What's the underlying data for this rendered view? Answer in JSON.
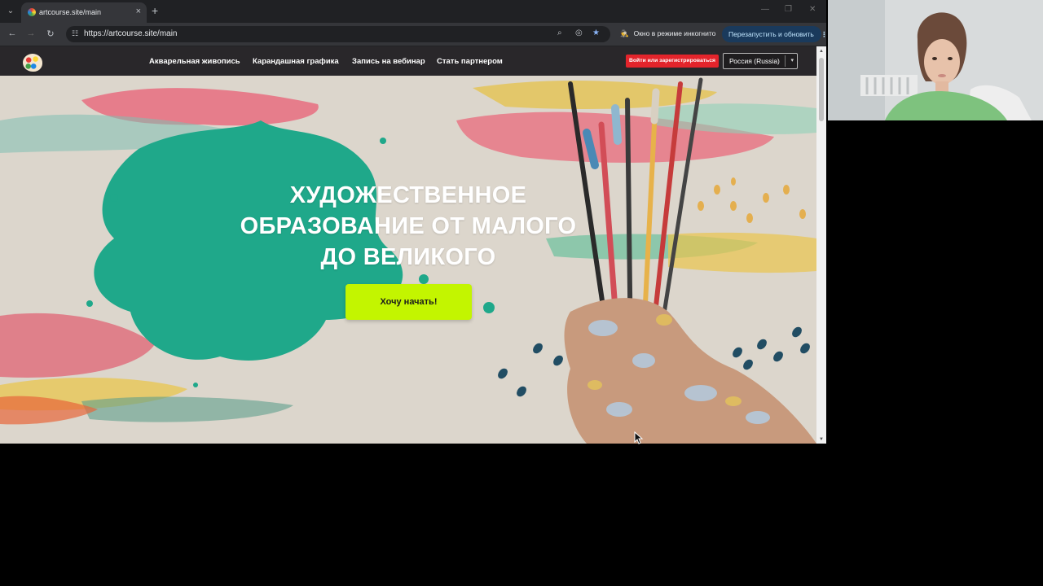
{
  "browser": {
    "tab_title": "artcourse.site/main",
    "tab_close": "×",
    "new_tab": "+",
    "url": "https://artcourse.site/main",
    "incognito_label": "Окно в режиме инкогнито",
    "relaunch_label": "Перезапустить и обновить",
    "relaunch_menu": "⋮",
    "icons": {
      "back": "←",
      "forward": "→",
      "reload": "↻",
      "tab_search": "⌄",
      "minimize": "—",
      "restore": "❐",
      "close": "✕",
      "zoom": "⌕",
      "eye_off": "◎",
      "star": "★",
      "site_info": "☷",
      "incognito": "🕵"
    }
  },
  "site": {
    "nav": {
      "links": [
        "Акварельная живопись",
        "Карандашная графика",
        "Запись на вебинар",
        "Стать партнером"
      ],
      "login_label": "Войти или зарегистрироваться",
      "region_value": "Россия (Russia)",
      "region_caret": "▾"
    },
    "hero": {
      "title_lines": [
        "ХУДОЖЕСТВЕННОЕ",
        "ОБРАЗОВАНИЕ ОТ МАЛОГО",
        "ДО ВЕЛИКОГО"
      ],
      "cta_label": "Хочу начать!"
    }
  },
  "colors": {
    "accent_cta": "#c3f500",
    "login_red": "#e3242b",
    "nav_bg": "#29272a",
    "hero_bg": "#dcd6cc",
    "teal_blot": "#1fa88a"
  }
}
